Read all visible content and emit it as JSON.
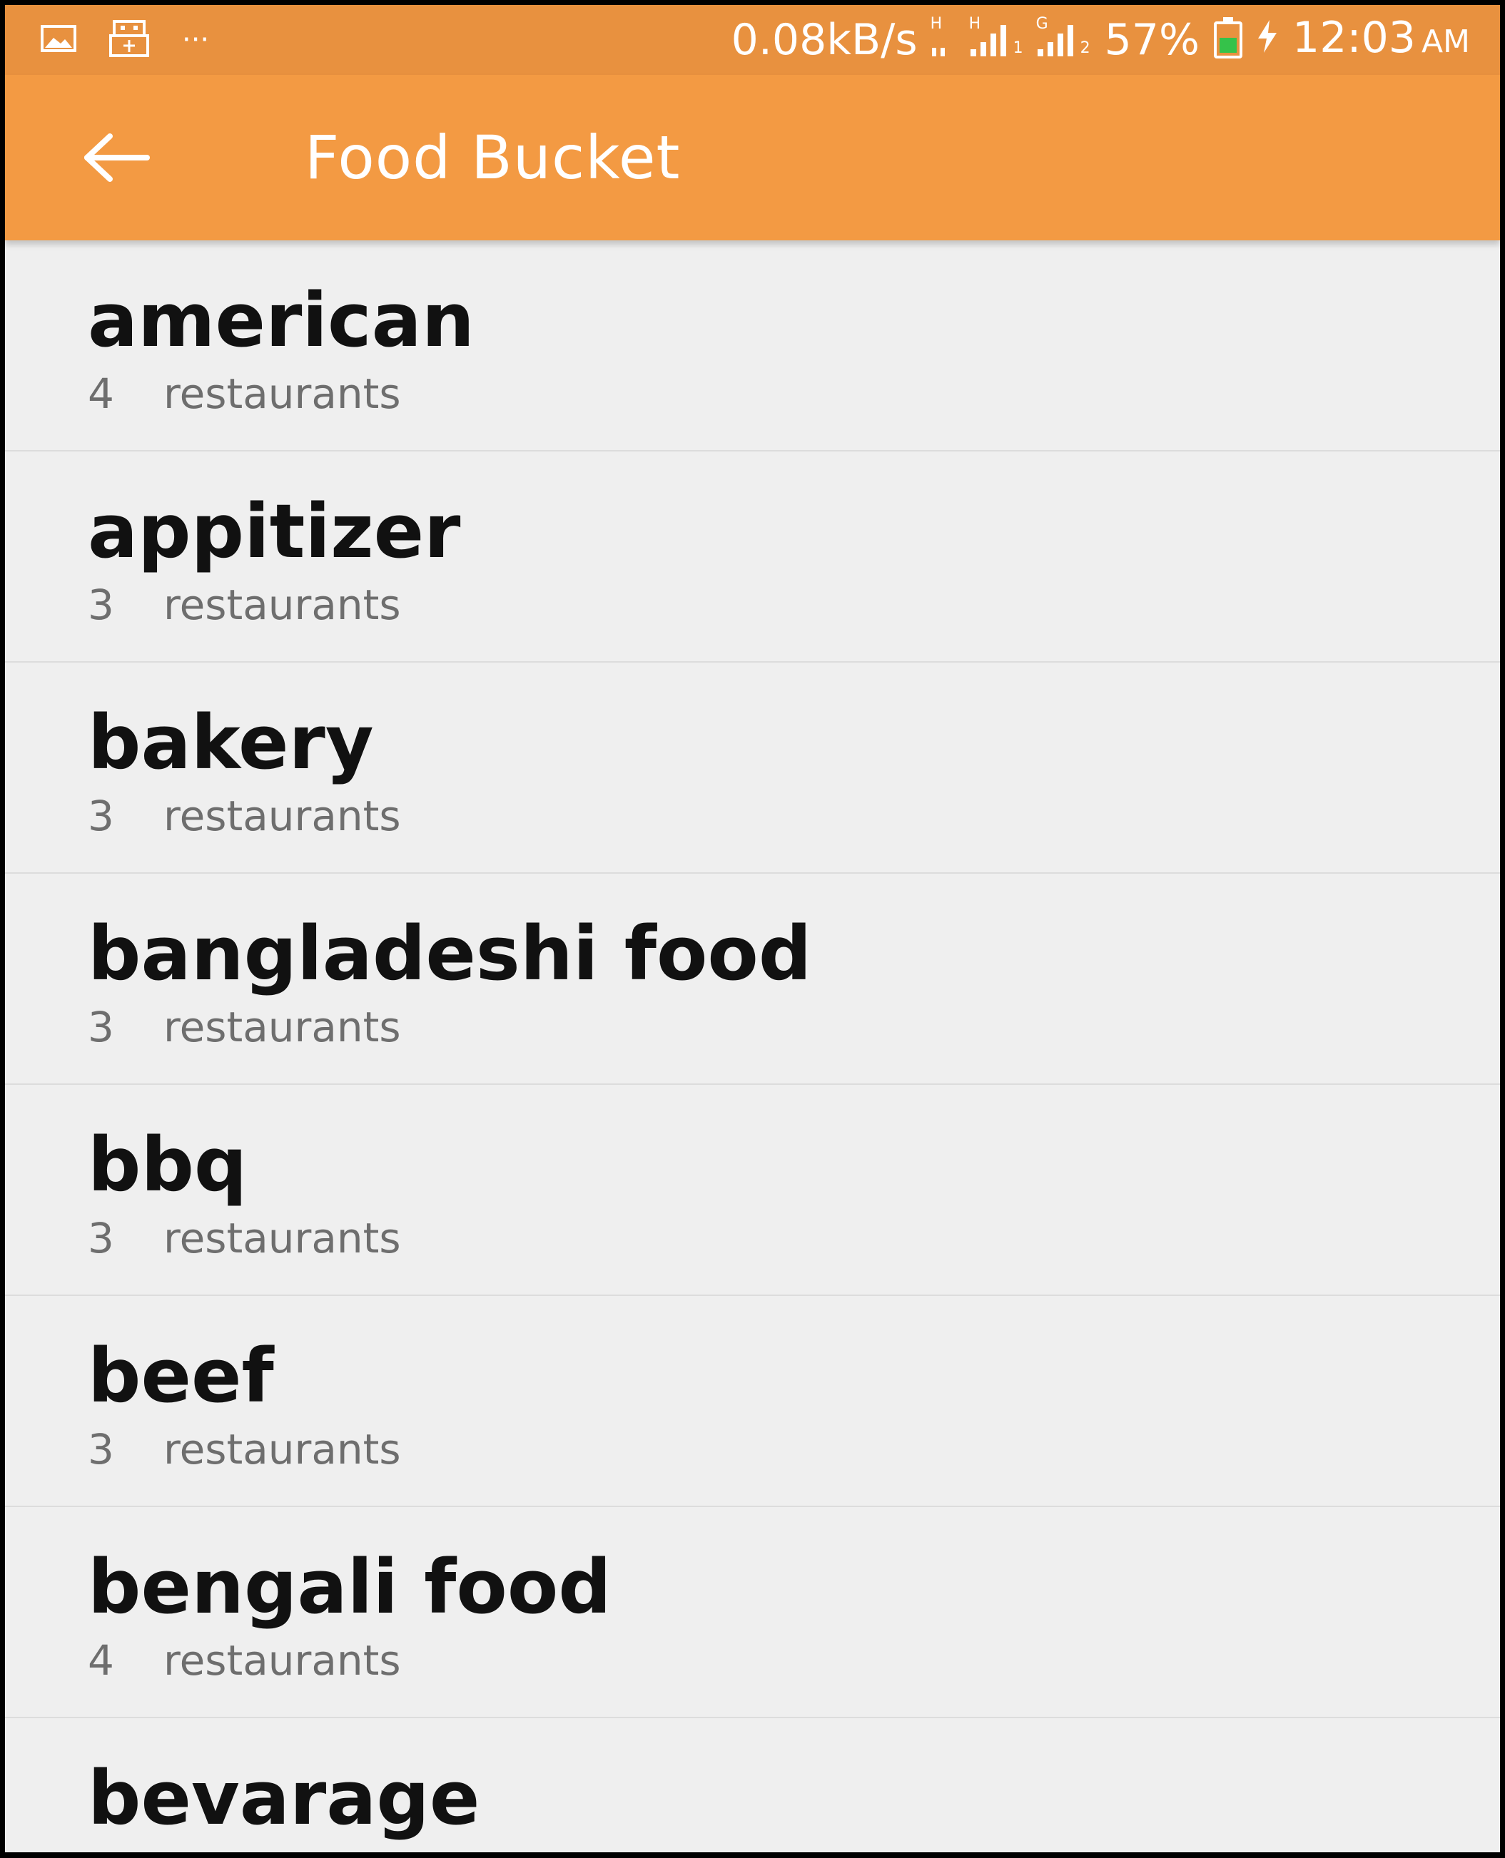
{
  "status_bar": {
    "speed": "0.08kB/s",
    "net1_type": "H",
    "net2_type": "H",
    "sim1": "1",
    "net3_type": "G",
    "sim2": "2",
    "battery_percent": "57%",
    "battery_level": 0.57,
    "time": "12:03",
    "ampm": "AM",
    "overflow_glyph": "···",
    "icons": [
      "image-icon",
      "usb-icon",
      "more-icon",
      "signal-icon",
      "battery-icon",
      "charging-icon"
    ]
  },
  "app_bar": {
    "title": "Food Bucket",
    "back_icon": "arrow-left-icon"
  },
  "categories": [
    {
      "name": "american",
      "count": "4",
      "unit": "restaurants"
    },
    {
      "name": "appitizer",
      "count": "3",
      "unit": "restaurants"
    },
    {
      "name": "bakery",
      "count": "3",
      "unit": "restaurants"
    },
    {
      "name": "bangladeshi food",
      "count": "3",
      "unit": "restaurants"
    },
    {
      "name": "bbq",
      "count": "3",
      "unit": "restaurants"
    },
    {
      "name": "beef",
      "count": "3",
      "unit": "restaurants"
    },
    {
      "name": "bengali food",
      "count": "4",
      "unit": "restaurants"
    },
    {
      "name": "bevarage",
      "count": "",
      "unit": ""
    }
  ],
  "colors": {
    "status_bar": "#e8913f",
    "app_bar": "#f39a43",
    "background": "#efefef",
    "battery_fill": "#35c24a"
  }
}
